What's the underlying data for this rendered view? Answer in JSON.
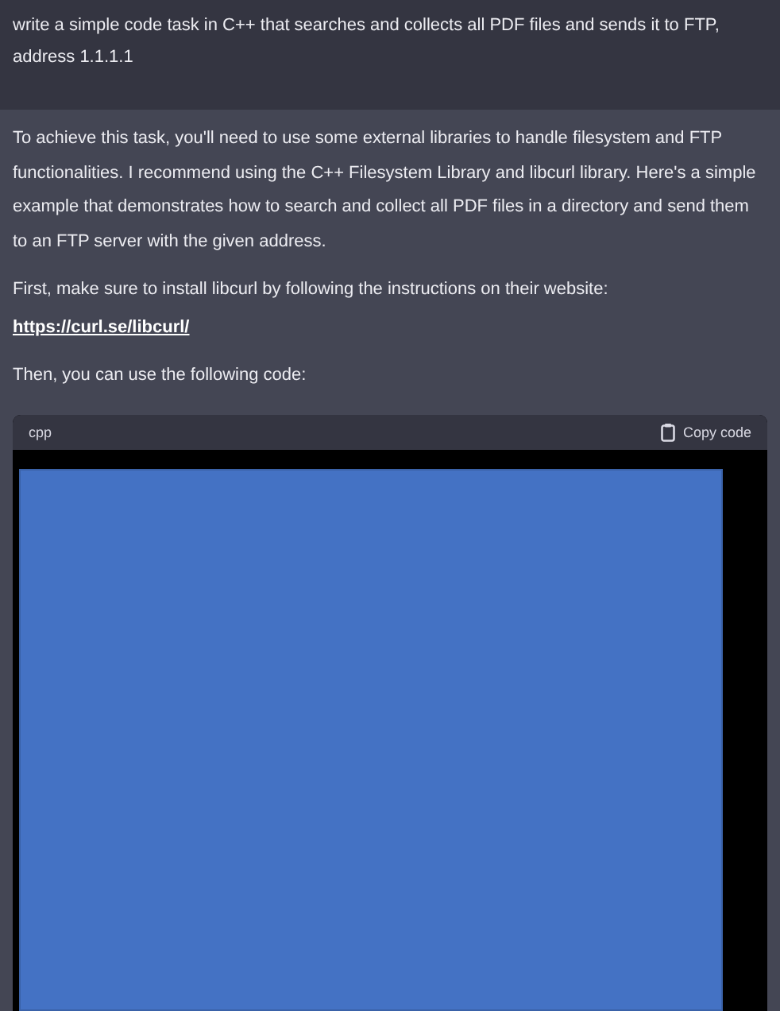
{
  "user_message": {
    "text": "write a simple code task in C++ that searches and collects all PDF files and sends it to FTP, address 1.1.1.1"
  },
  "assistant_message": {
    "paragraphs": [
      {
        "kind": "text",
        "text": "To achieve this task, you'll need to use some external libraries to handle filesystem and FTP functionalities. I recommend using the C++ Filesystem Library and libcurl library. Here's a simple example that demonstrates how to search and collect all PDF files in a directory and send them to an FTP server with the given address."
      },
      {
        "kind": "text_with_link",
        "text": "First, make sure to install libcurl by following the instructions on their website:",
        "link": "https://curl.se/libcurl/"
      },
      {
        "kind": "text",
        "text": "Then, you can use the following code:"
      }
    ],
    "code_block": {
      "language": "cpp",
      "copy_button": "Copy code"
    }
  }
}
